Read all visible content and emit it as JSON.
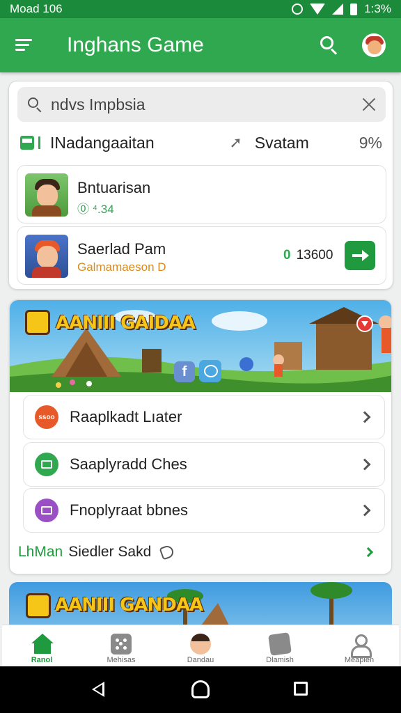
{
  "status_bar": {
    "time_left": "Moad 106",
    "time_right": "1:3%"
  },
  "app_bar": {
    "title": "Inghans Game",
    "menu_icon": "menu-icon",
    "search_icon": "search-icon",
    "avatar_icon": "avatar"
  },
  "search": {
    "value": "",
    "placeholder": "ndvs Impbsia"
  },
  "filter": {
    "label": "INadangaaitan",
    "status": "Svatam",
    "percent": "9%"
  },
  "items": [
    {
      "title": "Bntuarisan",
      "subtitle": "⓪ ⁴.34",
      "score_prefix": "",
      "score": ""
    },
    {
      "title": "Saerlad Pam",
      "subtitle": "Galmamaeson D",
      "score_prefix": "0",
      "score": "13600"
    }
  ],
  "banner": {
    "title": "AANIII GAIDAA"
  },
  "menu_rows": [
    {
      "label": "Raaplkadt Lıater",
      "icon": "game-icon",
      "icon_text": "ssoo"
    },
    {
      "label": "Saaplyradd Ches",
      "icon": "chess-icon",
      "icon_text": ""
    },
    {
      "label": "Fnoplyraat bbnes",
      "icon": "puzzle-icon",
      "icon_text": ""
    }
  ],
  "footer_row": {
    "brand": "LhMan",
    "label": "Siedler Sakd"
  },
  "banner2": {
    "title": "AANIII GANDAA"
  },
  "bottom_nav": [
    {
      "label": "Ranol",
      "icon": "home-icon",
      "active": true
    },
    {
      "label": "Mehisas",
      "icon": "dice-icon",
      "active": false
    },
    {
      "label": "Dandau",
      "icon": "player-icon",
      "active": false
    },
    {
      "label": "Dlamish",
      "icon": "chat-icon",
      "active": false
    },
    {
      "label": "Meaplen",
      "icon": "user-icon",
      "active": false
    }
  ],
  "colors": {
    "primary": "#2fa84f",
    "status_bar": "#1b8a3a",
    "accent_green": "#1f9a3e",
    "orange": "#d98b1e"
  }
}
